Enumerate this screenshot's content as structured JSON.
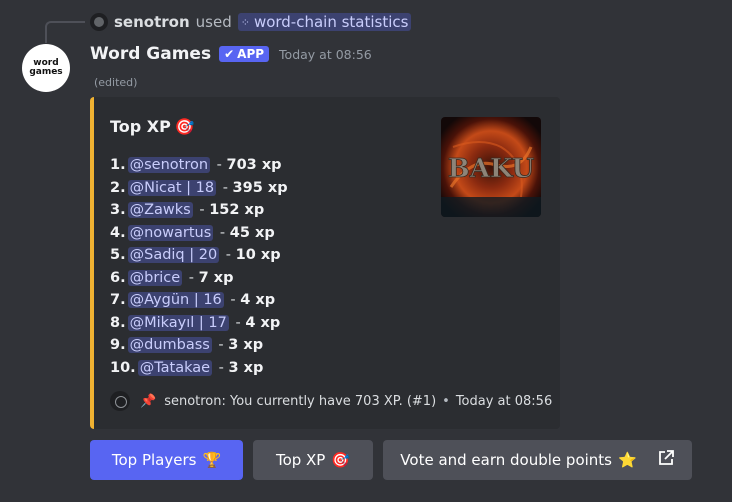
{
  "context": {
    "user": "senotron",
    "used_text": "used",
    "command": "word-chain statistics"
  },
  "header": {
    "bot_name": "Word Games",
    "avatar_line1": "word",
    "avatar_line2": "games",
    "badge": "APP",
    "timestamp": "Today at 08:56",
    "edited": "(edited)"
  },
  "embed": {
    "title": "Top XP",
    "title_emoji": "🎯",
    "accent": "#f0b232",
    "leaderboard": [
      {
        "rank": "1.",
        "name": "@senotron",
        "xp": "703 xp"
      },
      {
        "rank": "2.",
        "name": "@Nicat | 18",
        "xp": "395 xp"
      },
      {
        "rank": "3.",
        "name": "@Zawks",
        "xp": "152 xp"
      },
      {
        "rank": "4.",
        "name": "@nowartus",
        "xp": "45 xp"
      },
      {
        "rank": "5.",
        "name": "@Sadiq | 20",
        "xp": "10 xp"
      },
      {
        "rank": "6.",
        "name": "@brice",
        "xp": "7 xp"
      },
      {
        "rank": "7.",
        "name": "@Aygün | 16",
        "xp": "4 xp"
      },
      {
        "rank": "8.",
        "name": "@Mikayıl | 17",
        "xp": "4 xp"
      },
      {
        "rank": "9.",
        "name": "@dumbass",
        "xp": "3 xp"
      },
      {
        "rank": "10.",
        "name": "@Tatakae",
        "xp": "3 xp"
      }
    ],
    "footer_text": "senotron: You currently have 703 XP. (#1)",
    "footer_time": "Today at 08:56"
  },
  "buttons": [
    {
      "label": "Top Players",
      "emoji": "🏆"
    },
    {
      "label": "Top XP",
      "emoji": "🎯"
    },
    {
      "label": "Vote and earn double points",
      "emoji": "⭐"
    }
  ],
  "thumbnail_text": "BAKU"
}
